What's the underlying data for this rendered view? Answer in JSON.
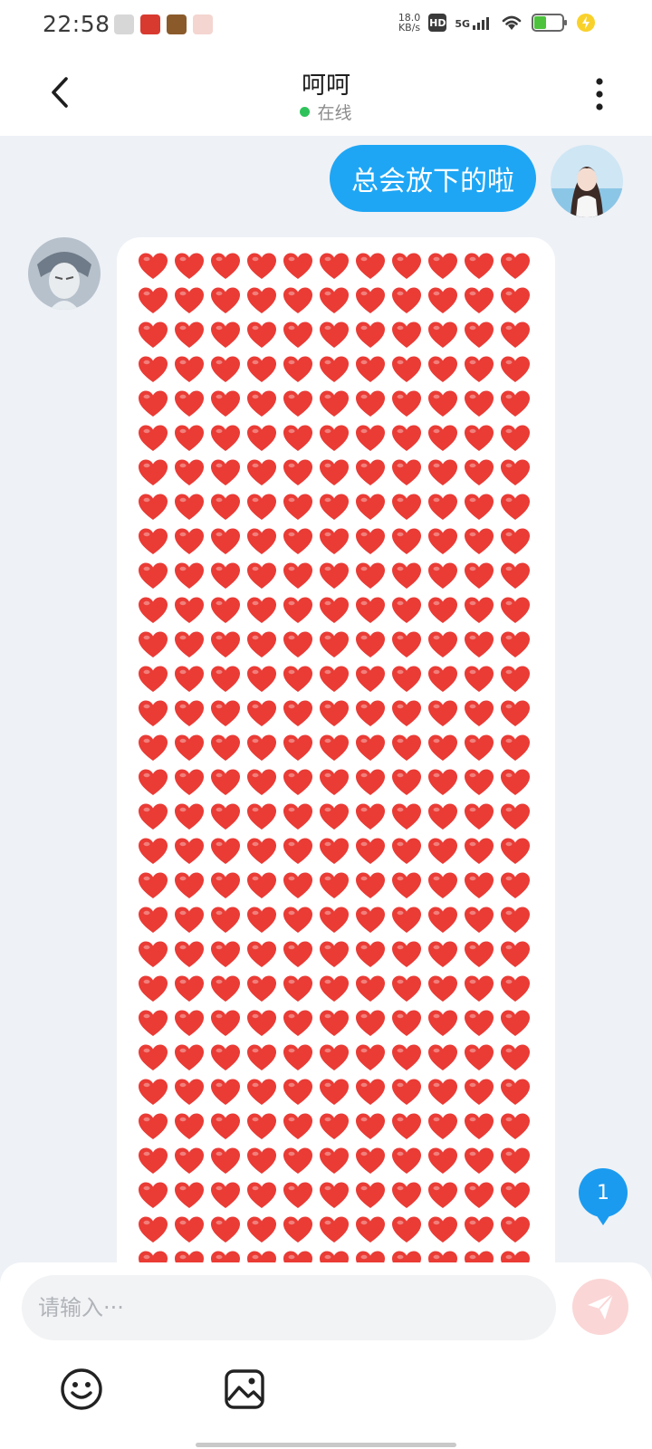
{
  "status_bar": {
    "time": "22:58",
    "net_speed_value": "18.0",
    "net_speed_unit": "KB/s",
    "hd_label": "HD",
    "network_label": "5G"
  },
  "header": {
    "title": "呵呵",
    "status": "在线"
  },
  "messages": {
    "outgoing_text": "总会放下的啦",
    "incoming_glyph": "❤️",
    "incoming_count": 330
  },
  "unread": {
    "count": "1"
  },
  "input": {
    "placeholder": "请输入···",
    "value": ""
  },
  "colors": {
    "outgoing_bubble": "#1ea6f5",
    "online_dot": "#2fc25b",
    "unread_badge": "#1a9bf0",
    "send_button_disabled": "#fbd6d6",
    "heart": "#ea3b35"
  },
  "icons": {
    "back": "chevron-left-icon",
    "more": "vertical-dots-icon",
    "send": "paper-plane-icon",
    "emoji": "smiley-face-icon",
    "image": "picture-icon"
  }
}
